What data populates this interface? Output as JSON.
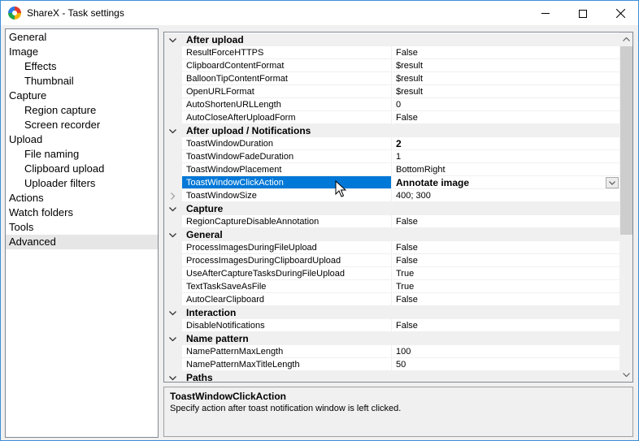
{
  "window": {
    "title": "ShareX - Task settings",
    "icon": "sharex-logo-icon"
  },
  "tree": {
    "items": [
      {
        "label": "General",
        "level": 0,
        "selected": false
      },
      {
        "label": "Image",
        "level": 0,
        "selected": false
      },
      {
        "label": "Effects",
        "level": 1,
        "selected": false
      },
      {
        "label": "Thumbnail",
        "level": 1,
        "selected": false
      },
      {
        "label": "Capture",
        "level": 0,
        "selected": false
      },
      {
        "label": "Region capture",
        "level": 1,
        "selected": false
      },
      {
        "label": "Screen recorder",
        "level": 1,
        "selected": false
      },
      {
        "label": "Upload",
        "level": 0,
        "selected": false
      },
      {
        "label": "File naming",
        "level": 1,
        "selected": false
      },
      {
        "label": "Clipboard upload",
        "level": 1,
        "selected": false
      },
      {
        "label": "Uploader filters",
        "level": 1,
        "selected": false
      },
      {
        "label": "Actions",
        "level": 0,
        "selected": false
      },
      {
        "label": "Watch folders",
        "level": 0,
        "selected": false
      },
      {
        "label": "Tools",
        "level": 0,
        "selected": false
      },
      {
        "label": "Advanced",
        "level": 0,
        "selected": true
      }
    ]
  },
  "grid": {
    "rows": [
      {
        "type": "category",
        "name": "After upload",
        "toggle": "collapse-icon"
      },
      {
        "type": "prop",
        "name": "ResultForceHTTPS",
        "value": "False"
      },
      {
        "type": "prop",
        "name": "ClipboardContentFormat",
        "value": "$result"
      },
      {
        "type": "prop",
        "name": "BalloonTipContentFormat",
        "value": "$result"
      },
      {
        "type": "prop",
        "name": "OpenURLFormat",
        "value": "$result"
      },
      {
        "type": "prop",
        "name": "AutoShortenURLLength",
        "value": "0"
      },
      {
        "type": "prop",
        "name": "AutoCloseAfterUploadForm",
        "value": "False"
      },
      {
        "type": "category",
        "name": "After upload / Notifications",
        "toggle": "collapse-icon"
      },
      {
        "type": "prop",
        "name": "ToastWindowDuration",
        "value": "2",
        "bold": true
      },
      {
        "type": "prop",
        "name": "ToastWindowFadeDuration",
        "value": "1"
      },
      {
        "type": "prop",
        "name": "ToastWindowPlacement",
        "value": "BottomRight"
      },
      {
        "type": "prop",
        "name": "ToastWindowClickAction",
        "value": "Annotate image",
        "bold": true,
        "selected": true,
        "dropdown": true
      },
      {
        "type": "prop",
        "name": "ToastWindowSize",
        "value": "400; 300",
        "expand": true
      },
      {
        "type": "category",
        "name": "Capture",
        "toggle": "collapse-icon"
      },
      {
        "type": "prop",
        "name": "RegionCaptureDisableAnnotation",
        "value": "False"
      },
      {
        "type": "category",
        "name": "General",
        "toggle": "collapse-icon"
      },
      {
        "type": "prop",
        "name": "ProcessImagesDuringFileUpload",
        "value": "False"
      },
      {
        "type": "prop",
        "name": "ProcessImagesDuringClipboardUpload",
        "value": "False"
      },
      {
        "type": "prop",
        "name": "UseAfterCaptureTasksDuringFileUpload",
        "value": "True"
      },
      {
        "type": "prop",
        "name": "TextTaskSaveAsFile",
        "value": "True"
      },
      {
        "type": "prop",
        "name": "AutoClearClipboard",
        "value": "False"
      },
      {
        "type": "category",
        "name": "Interaction",
        "toggle": "collapse-icon"
      },
      {
        "type": "prop",
        "name": "DisableNotifications",
        "value": "False"
      },
      {
        "type": "category",
        "name": "Name pattern",
        "toggle": "collapse-icon"
      },
      {
        "type": "prop",
        "name": "NamePatternMaxLength",
        "value": "100"
      },
      {
        "type": "prop",
        "name": "NamePatternMaxTitleLength",
        "value": "50"
      },
      {
        "type": "category",
        "name": "Paths",
        "toggle": "collapse-icon"
      }
    ]
  },
  "help": {
    "title": "ToastWindowClickAction",
    "description": "Specify action after toast notification window is left clicked."
  },
  "colors": {
    "selection": "#0078d7",
    "window_border": "#3c8fd8",
    "category_bg": "#f0f0f0"
  }
}
